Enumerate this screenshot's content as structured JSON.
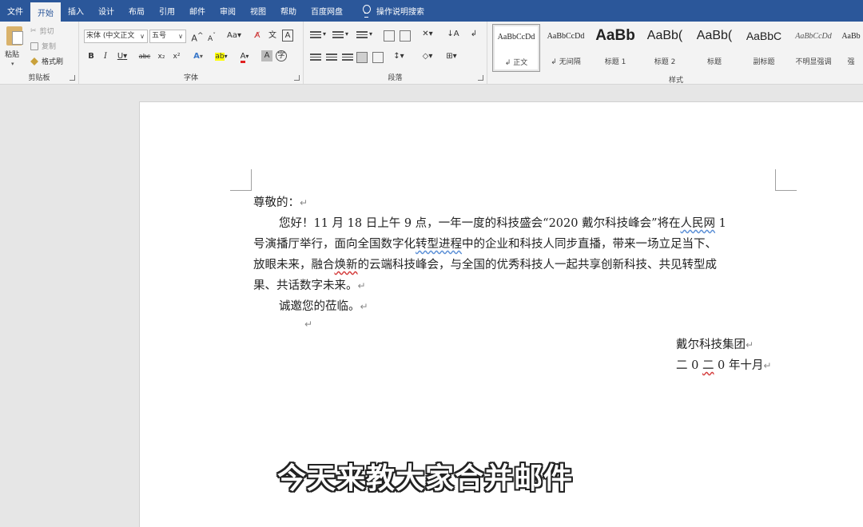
{
  "tabs": [
    "文件",
    "开始",
    "插入",
    "设计",
    "布局",
    "引用",
    "邮件",
    "审阅",
    "视图",
    "帮助",
    "百度网盘"
  ],
  "tab_search": "操作说明搜索",
  "clipboard": {
    "paste": "粘贴",
    "cut": "剪切",
    "copy": "复制",
    "format_painter": "格式刷",
    "label": "剪贴板"
  },
  "font": {
    "name_value": "宋体 (中文正文",
    "size_value": "五号",
    "grow": "A",
    "shrink": "A",
    "case": "Aa",
    "bold": "B",
    "italic": "I",
    "underline": "U",
    "strike": "abc",
    "subscript": "x₂",
    "superscript": "x²",
    "effects": "A",
    "highlight": "ab",
    "color": "A",
    "label": "字体"
  },
  "paragraph": {
    "label": "段落"
  },
  "styles": {
    "label": "样式",
    "items": [
      {
        "sample": "AaBbCcDd",
        "name": "↲ 正文"
      },
      {
        "sample": "AaBbCcDd",
        "name": "↲ 无间隔"
      },
      {
        "sample": "AaBb",
        "name": "标题 1"
      },
      {
        "sample": "AaBb(",
        "name": "标题 2"
      },
      {
        "sample": "AaBb(",
        "name": "标题"
      },
      {
        "sample": "AaBbC",
        "name": "副标题"
      },
      {
        "sample": "AaBbCcDd",
        "name": "不明显强调"
      },
      {
        "sample": "AaBb",
        "name": "强"
      }
    ]
  },
  "document": {
    "salutation": "尊敬的：",
    "line1_a": "您好！11 月 18 日上午 9 点，一年一度的科技盛会“2020 戴尔科技峰会”将在",
    "line1_b": "人民网",
    "line1_c": " 1",
    "line2_a": "号演播厅举行，面向全国数字化",
    "line2_b": "转型进程",
    "line2_c": "中的企业和科技人同步直播，带来一场立足当下、",
    "line3_a": "放眼未来，融合",
    "line3_b": "焕新",
    "line3_c": "的云端科技峰会，与全国的优秀科技人一起共享创新科技、共见转型成",
    "line4": "果、共话数字未来。",
    "invite": "诚邀您的莅临。",
    "signature": "戴尔科技集团",
    "date_a": "二 0 ",
    "date_b": "二",
    "date_c": " 0 年十月",
    "para_mark": "↵"
  },
  "caption": "今天来教大家合并邮件"
}
